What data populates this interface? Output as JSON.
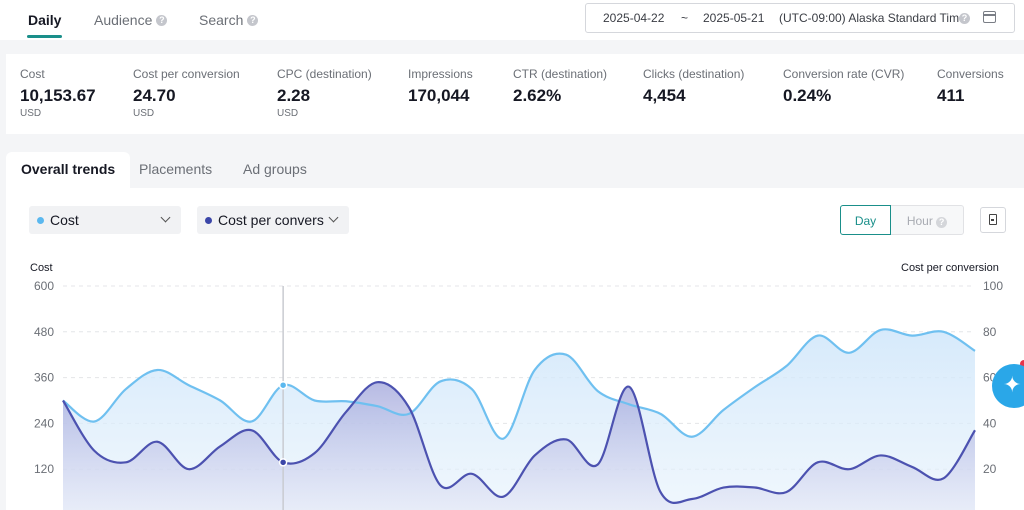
{
  "top_tabs": [
    {
      "label": "Daily",
      "active": true,
      "help": false
    },
    {
      "label": "Audience",
      "active": false,
      "help": true
    },
    {
      "label": "Search",
      "active": false,
      "help": true
    }
  ],
  "date_range": {
    "start": "2025-04-22",
    "separator": "~",
    "end": "2025-05-21",
    "timezone": "(UTC-09:00) Alaska Standard Time"
  },
  "metrics": [
    {
      "label": "Cost",
      "value": "10,153.67",
      "unit": "USD"
    },
    {
      "label": "Cost per conversion",
      "value": "24.70",
      "unit": "USD"
    },
    {
      "label": "CPC (destination)",
      "value": "2.28",
      "unit": "USD"
    },
    {
      "label": "Impressions",
      "value": "170,044",
      "unit": ""
    },
    {
      "label": "CTR (destination)",
      "value": "2.62%",
      "unit": ""
    },
    {
      "label": "Clicks (destination)",
      "value": "4,454",
      "unit": ""
    },
    {
      "label": "Conversion rate (CVR)",
      "value": "0.24%",
      "unit": ""
    },
    {
      "label": "Conversions",
      "value": "411",
      "unit": ""
    }
  ],
  "sub_tabs": [
    "Overall trends",
    "Placements",
    "Ad groups"
  ],
  "metric_selectors": [
    {
      "label": "Cost",
      "color": "#5bb8ef"
    },
    {
      "label": "Cost per convers",
      "color": "#3b46a8"
    }
  ],
  "granularity": {
    "day": "Day",
    "hour": "Hour"
  },
  "colors": {
    "accent": "#1a8f8a",
    "cost": "#5bb8ef",
    "cpc": "#4c52b0"
  },
  "chart_data": {
    "type": "area",
    "left_axis_title": "Cost",
    "right_axis_title": "Cost per conversion",
    "left_ticks": [
      "600",
      "480",
      "360",
      "240",
      "120"
    ],
    "right_ticks": [
      "100",
      "80",
      "60",
      "40",
      "20"
    ],
    "ylim_left": [
      0,
      600
    ],
    "ylim_right": [
      0,
      100
    ],
    "grid": true,
    "series": [
      {
        "name": "Cost",
        "axis": "left",
        "values": [
          300,
          245,
          330,
          380,
          340,
          300,
          245,
          340,
          300,
          298,
          285,
          265,
          350,
          330,
          200,
          380,
          420,
          325,
          290,
          265,
          205,
          275,
          335,
          390,
          470,
          425,
          485,
          470,
          480,
          430
        ]
      },
      {
        "name": "Cost per conversion",
        "axis": "right",
        "values": [
          50,
          28,
          23,
          32,
          20,
          30,
          37,
          23,
          27,
          45,
          58,
          47,
          13,
          18,
          8,
          26,
          33,
          22,
          56,
          10,
          7,
          12,
          12,
          10,
          23,
          20,
          26,
          21,
          16,
          37
        ]
      }
    ],
    "hover_index": 7
  }
}
